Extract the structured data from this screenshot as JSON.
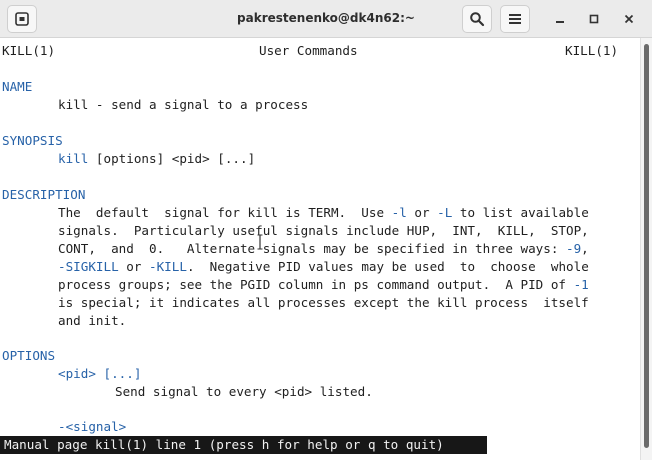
{
  "window": {
    "title": "pakrestenenko@dk4n62:~"
  },
  "titlebar": {
    "new_tab_icon": "new-tab-icon",
    "search_icon": "search-icon",
    "menu_icon": "hamburger-menu-icon",
    "minimize_icon": "minimize-icon",
    "maximize_icon": "maximize-icon",
    "close_icon": "close-icon"
  },
  "colors": {
    "heading": "#2762a8",
    "text": "#1f1f1f",
    "status_bg": "#171717",
    "status_fg": "#f2f2f2"
  },
  "man": {
    "header_left": "KILL(1)",
    "header_center": "User Commands",
    "header_right": "KILL(1)",
    "name_heading": "NAME",
    "name_text": "kill - send a signal to a process",
    "synopsis_heading": "SYNOPSIS",
    "synopsis_cmd": "kill",
    "synopsis_args": " [options] <pid> [...]",
    "description_heading": "DESCRIPTION",
    "desc_l1a": "The  default  signal for kill is TERM.  Use ",
    "desc_l1_opt1": "-l",
    "desc_l1b": " or ",
    "desc_l1_opt2": "-L",
    "desc_l1c": " to list available",
    "desc_l2": "signals.  Particularly useful signals include HUP,  INT,  KILL,  STOP,",
    "desc_l3a": "CONT,  and  0.   Alternate signals may be specified in three ways: ",
    "desc_l3_opt": "-9",
    "desc_l3b": ",",
    "desc_l4_opt1": "-SIGKILL",
    "desc_l4a": " or ",
    "desc_l4_opt2": "-KILL",
    "desc_l4b": ".  Negative PID values may be used  to  choose  whole",
    "desc_l5a": "process groups; see the PGID column in ps command output.  A PID of ",
    "desc_l5_opt": "-1",
    "desc_l6": "is special; it indicates all processes except the kill process  itself",
    "desc_l7": "and init.",
    "options_heading": "OPTIONS",
    "opt_pid": "<pid> [...]",
    "opt_pid_desc": "Send signal to every <pid> listed.",
    "opt_signal": "-<signal>"
  },
  "status_line": "Manual page kill(1) line 1 (press h for help or q to quit)"
}
